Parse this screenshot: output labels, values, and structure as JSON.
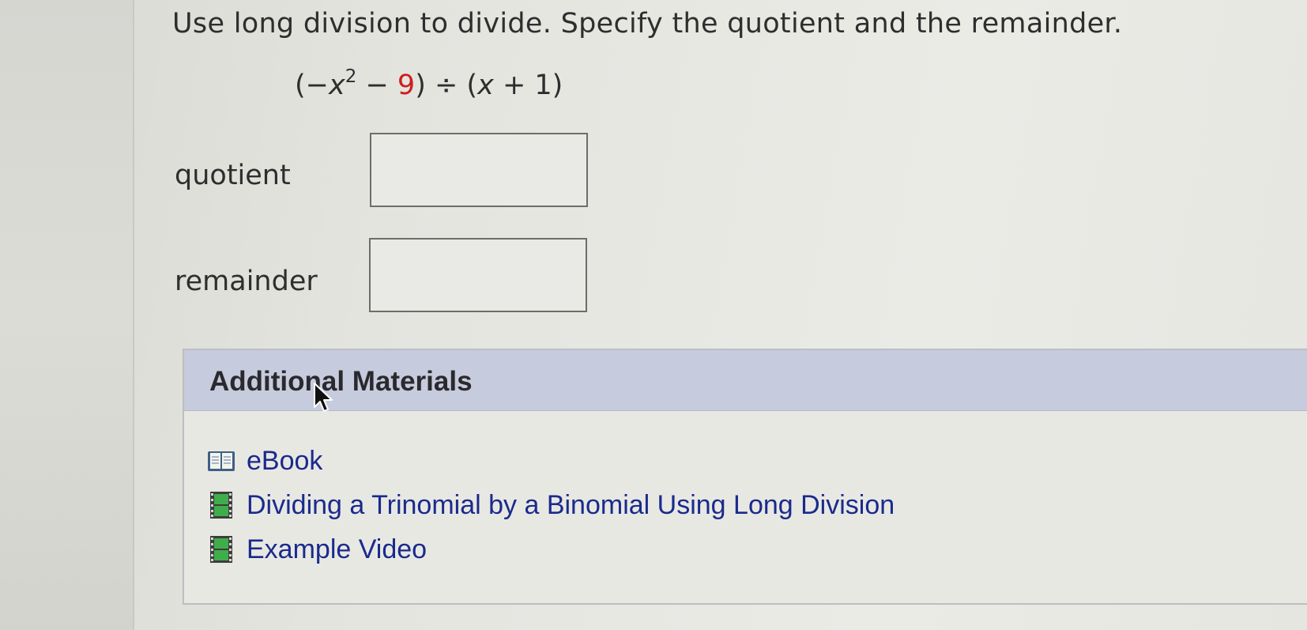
{
  "question": {
    "prompt": "Use long division to divide. Specify the quotient and the remainder."
  },
  "expression": {
    "open1": "(−",
    "var1": "x",
    "exp": "2",
    "minus": " − ",
    "constant": "9",
    "close1": ") ÷ (",
    "var2": "x",
    "tail": " + 1)"
  },
  "answers": {
    "quotient_label": "quotient",
    "quotient_value": "",
    "remainder_label": "remainder",
    "remainder_value": ""
  },
  "additional_materials": {
    "title": "Additional Materials",
    "items": [
      {
        "icon": "book-icon",
        "label": "eBook"
      },
      {
        "icon": "film-icon",
        "label": "Dividing a Trinomial by a Binomial Using Long Division"
      },
      {
        "icon": "film-icon",
        "label": "Example Video"
      }
    ]
  },
  "colors": {
    "link": "#1a2a8c",
    "header_bg": "#c6cbdd",
    "highlight_red": "#cc1f1f"
  }
}
